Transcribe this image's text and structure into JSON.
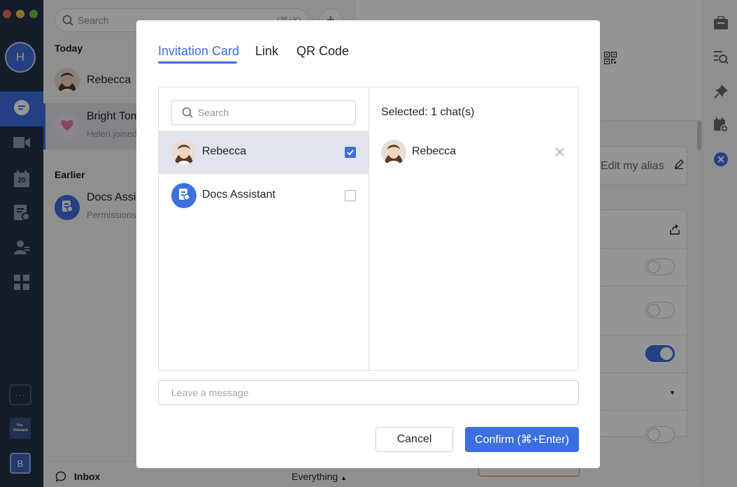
{
  "colors": {
    "accent": "#3d6fe0",
    "rail_bg": "#243247",
    "danger": "#e9726c"
  },
  "rail": {
    "avatar_letter": "H",
    "calendar_day": "20",
    "more_label": "···",
    "preonboard_label": "Pre-\nOnboard",
    "workspace_letter": "B",
    "icons": [
      "chat-icon",
      "video-icon",
      "calendar-icon",
      "docs-icon",
      "contacts-icon",
      "workplace-icon"
    ]
  },
  "chatlist": {
    "search_placeholder": "Search",
    "search_shortcut": "(⌘+K)",
    "add_label": "+",
    "today_label": "Today",
    "earlier_label": "Earlier",
    "chats": [
      {
        "name": "Rebecca",
        "subtitle": ""
      },
      {
        "name": "Bright Tom",
        "subtitle": "Helen joined"
      },
      {
        "name": "Docs Assis",
        "subtitle": "Permissions"
      }
    ],
    "footer": {
      "inbox_label": "Inbox",
      "filter_label": "Everything"
    }
  },
  "right_panel": {
    "alias_label": "Edit my alias",
    "toggles": [
      false,
      false,
      true,
      false
    ]
  },
  "right_rail": {
    "icons": [
      "briefcase-icon",
      "search-doc-icon",
      "pin-icon",
      "calendar-add-icon",
      "close-circle-icon"
    ]
  },
  "modal": {
    "tabs": [
      {
        "label": "Invitation Card",
        "active": true
      },
      {
        "label": "Link",
        "active": false
      },
      {
        "label": "QR Code",
        "active": false
      }
    ],
    "search_placeholder": "Search",
    "candidates": [
      {
        "name": "Rebecca",
        "checked": true
      },
      {
        "name": "Docs Assistant",
        "checked": false
      }
    ],
    "selected_count_label": "Selected: 1 chat(s)",
    "selected": [
      {
        "name": "Rebecca"
      }
    ],
    "message_placeholder": "Leave a message",
    "cancel_label": "Cancel",
    "confirm_label": "Confirm (⌘+Enter)"
  }
}
